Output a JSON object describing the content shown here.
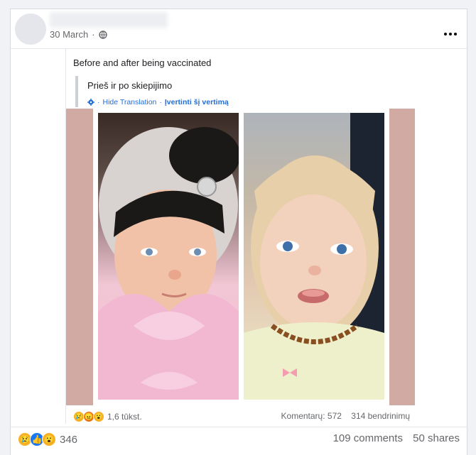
{
  "post": {
    "date": "30 March",
    "caption": "Before and after being vaccinated"
  },
  "shared": {
    "original_text": "Prieš ir po skiepijimo",
    "hide_translation": "Hide Translation",
    "rate_translation": "Įvertinti šį vertimą",
    "separator": "·",
    "reaction_count": "1,6 tūkst.",
    "comments": "Komentarų: 572",
    "shares": "314 bendrinimų"
  },
  "footer": {
    "reaction_count": "346",
    "comments": "109 comments",
    "shares": "50 shares"
  },
  "colors": {
    "link": "#216fdb",
    "photo_border": "#d1aba3",
    "like_blue": "#1877f2",
    "angry": "#e9710f",
    "sad_wow": "#f7b125"
  }
}
